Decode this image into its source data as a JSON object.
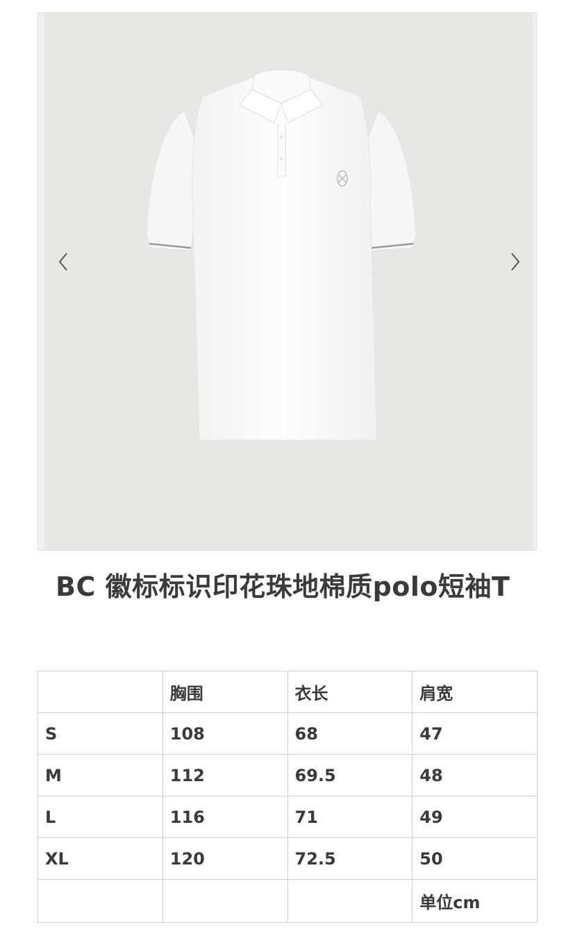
{
  "product": {
    "title": "BC 徽标标识印花珠地棉质polo短袖T"
  },
  "gallery": {
    "image_alt": "white polo shirt",
    "prev_icon": "chevron-left-icon",
    "next_icon": "chevron-right-icon"
  },
  "size_table": {
    "headers": [
      "",
      "胸围",
      "衣长",
      "肩宽"
    ],
    "rows": [
      [
        "S",
        "108",
        "68",
        "47"
      ],
      [
        "M",
        "112",
        "69.5",
        "48"
      ],
      [
        "L",
        "116",
        "71",
        "49"
      ],
      [
        "XL",
        "120",
        "72.5",
        "50"
      ],
      [
        "",
        "",
        "",
        "单位cm"
      ]
    ]
  }
}
